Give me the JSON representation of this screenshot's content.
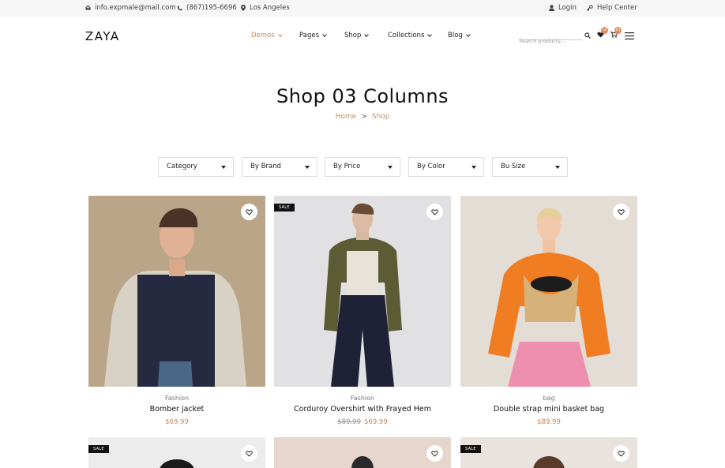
{
  "topbar": {
    "email": "info.expmale@mail.com",
    "phone": "(867)195-6696",
    "location": "Los Angeles",
    "login": "Login",
    "help": "Help Center",
    "icons": [
      "mail-icon",
      "phone-icon",
      "location-pin-icon",
      "user-icon",
      "help-icon"
    ]
  },
  "header": {
    "logo": "ZAYA",
    "nav": [
      {
        "label": "Demos",
        "active": true
      },
      {
        "label": "Pages",
        "active": false
      },
      {
        "label": "Shop",
        "active": false
      },
      {
        "label": "Collections",
        "active": false
      },
      {
        "label": "Blog",
        "active": false
      }
    ],
    "search_placeholder": "Search products...",
    "wishlist_count": "10",
    "cart_count": "05",
    "accent_color": "#c58a5e",
    "badge_color": "#e08a5a"
  },
  "hero": {
    "title": "Shop 03 Columns",
    "breadcrumb": {
      "home": "Home",
      "separator": ">",
      "current": "Shop"
    }
  },
  "filters": [
    {
      "label": "Category"
    },
    {
      "label": "By Brand"
    },
    {
      "label": "By Price"
    },
    {
      "label": "By Color"
    },
    {
      "label": "Bu Size"
    }
  ],
  "products": [
    {
      "category": "Fashion",
      "name": "Bomber jacket",
      "old_price": "",
      "price": "$69.99",
      "sale": false
    },
    {
      "category": "Fashion",
      "name": "Corduroy Overshirt with Frayed Hem",
      "old_price": "$89.99",
      "price": "$69.99",
      "sale": true,
      "sale_label": "SALE"
    },
    {
      "category": "bag",
      "name": "Double strap mini basket bag",
      "old_price": "",
      "price": "$89.99",
      "sale": false
    },
    {
      "sale": true,
      "sale_label": "SALE"
    },
    {
      "sale": false
    },
    {
      "sale": true,
      "sale_label": "SALE"
    }
  ]
}
